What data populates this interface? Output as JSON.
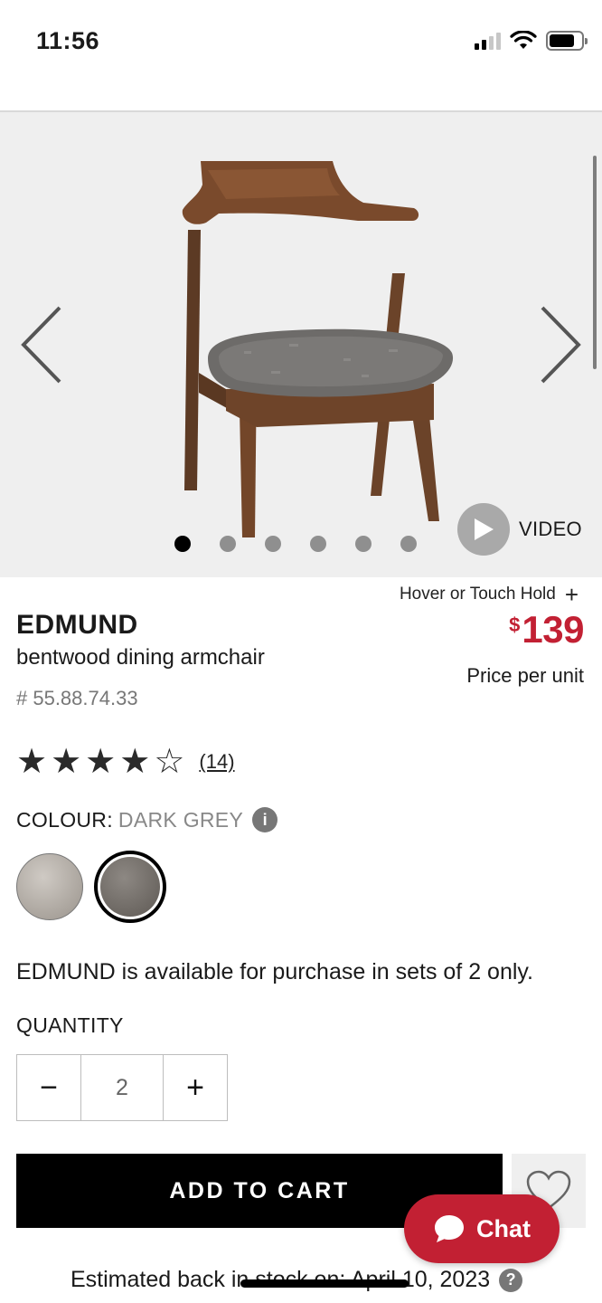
{
  "status_bar": {
    "time": "11:56"
  },
  "gallery": {
    "image_count": 6,
    "active_index": 0,
    "video_label": "VIDEO"
  },
  "product": {
    "zoom_hint": "Hover or Touch Hold",
    "zoom_plus": "+",
    "name": "EDMUND",
    "subtitle": "bentwood dining armchair",
    "sku": "# 55.88.74.33",
    "price_currency": "$",
    "price_amount": "139",
    "price_note": "Price per unit",
    "price_color": "#c22033"
  },
  "rating": {
    "stars_filled": 4,
    "stars_total": 5,
    "review_count": "(14)"
  },
  "colour": {
    "label": "COLOUR:",
    "value": "DARK GREY",
    "info_icon": "info-icon"
  },
  "availability": "EDMUND is available for purchase in sets of 2 only.",
  "quantity": {
    "label": "QUANTITY",
    "value": "2",
    "minus": "−",
    "plus": "+"
  },
  "actions": {
    "add_to_cart": "ADD TO CART",
    "wishlist_icon": "heart-icon",
    "chat_label": "Chat"
  },
  "stock": {
    "text": "Estimated back in stock on: April 10, 2023",
    "help": "?"
  }
}
